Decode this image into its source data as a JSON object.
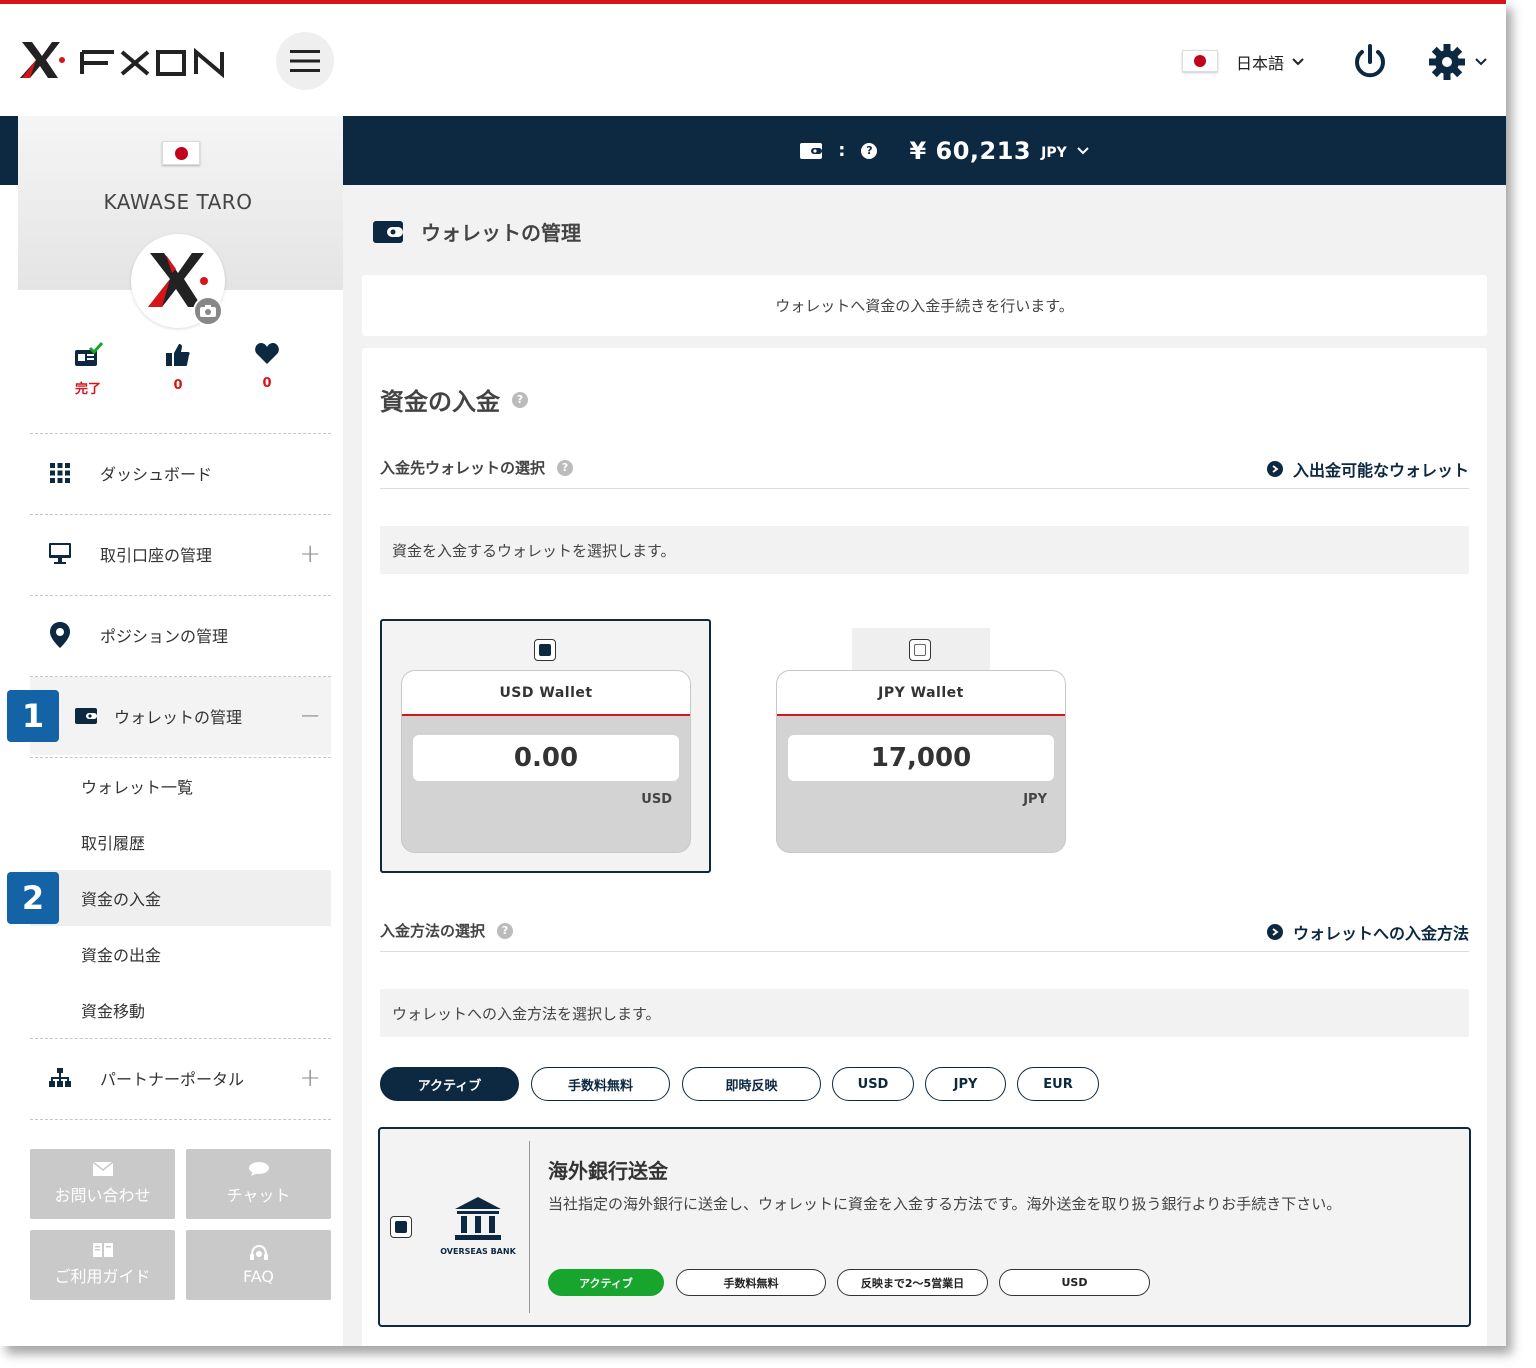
{
  "header": {
    "brand": "FXON",
    "language": "日本語"
  },
  "balance": {
    "amount": "¥ 60,213",
    "currency": "JPY"
  },
  "profile": {
    "name": "KAWASE TARO",
    "stats": [
      {
        "icon": "id-card-check-icon",
        "value": "完了"
      },
      {
        "icon": "thumbs-up-icon",
        "value": "0"
      },
      {
        "icon": "heart-icon",
        "value": "0"
      }
    ]
  },
  "sidebar": {
    "items": [
      {
        "label": "ダッシュボード",
        "icon": "grid-icon"
      },
      {
        "label": "取引口座の管理",
        "icon": "monitor-icon",
        "toggle": "+"
      },
      {
        "label": "ポジションの管理",
        "icon": "map-pin-icon"
      },
      {
        "label": "ウォレットの管理",
        "icon": "wallet-icon",
        "toggle": "−"
      },
      {
        "label": "パートナーポータル",
        "icon": "sitemap-icon",
        "toggle": "+"
      }
    ],
    "wallet_sub": [
      "ウォレット一覧",
      "取引履歴",
      "資金の入金",
      "資金の出金",
      "資金移動"
    ],
    "badges": [
      "1",
      "2"
    ],
    "buttons": [
      {
        "label": "お問い合わせ",
        "icon": "envelope-icon"
      },
      {
        "label": "チャット",
        "icon": "chat-icon"
      },
      {
        "label": "ご利用ガイド",
        "icon": "guide-icon"
      },
      {
        "label": "FAQ",
        "icon": "headset-icon"
      }
    ]
  },
  "main": {
    "page_title": "ウォレットの管理",
    "notice": "ウォレットへ資金の入金手続きを行います。",
    "section_title": "資金の入金",
    "wallet_select": {
      "label": "入金先ウォレットの選択",
      "link": "入出金可能なウォレット",
      "hint": "資金を入金するウォレットを選択します。",
      "wallets": [
        {
          "name": "USD Wallet",
          "value": "0.00",
          "currency": "USD",
          "selected": true
        },
        {
          "name": "JPY Wallet",
          "value": "17,000",
          "currency": "JPY",
          "selected": false
        }
      ]
    },
    "method_select": {
      "label": "入金方法の選択",
      "link": "ウォレットへの入金方法",
      "hint": "ウォレットへの入金方法を選択します。",
      "filters": [
        "アクティブ",
        "手数料無料",
        "即時反映",
        "USD",
        "JPY",
        "EUR"
      ],
      "method": {
        "icon_caption": "OVERSEAS BANK",
        "title": "海外銀行送金",
        "description": "当社指定の海外銀行に送金し、ウォレットに資金を入金する方法です。海外送金を取り扱う銀行よりお手続き下さい。",
        "tags": [
          "アクティブ",
          "手数料無料",
          "反映まで2〜5営業日",
          "USD"
        ]
      }
    }
  },
  "colors": {
    "navy": "#0d2841",
    "red": "#d7141a",
    "badge_blue": "#1363a6",
    "active_green": "#17a52d"
  }
}
